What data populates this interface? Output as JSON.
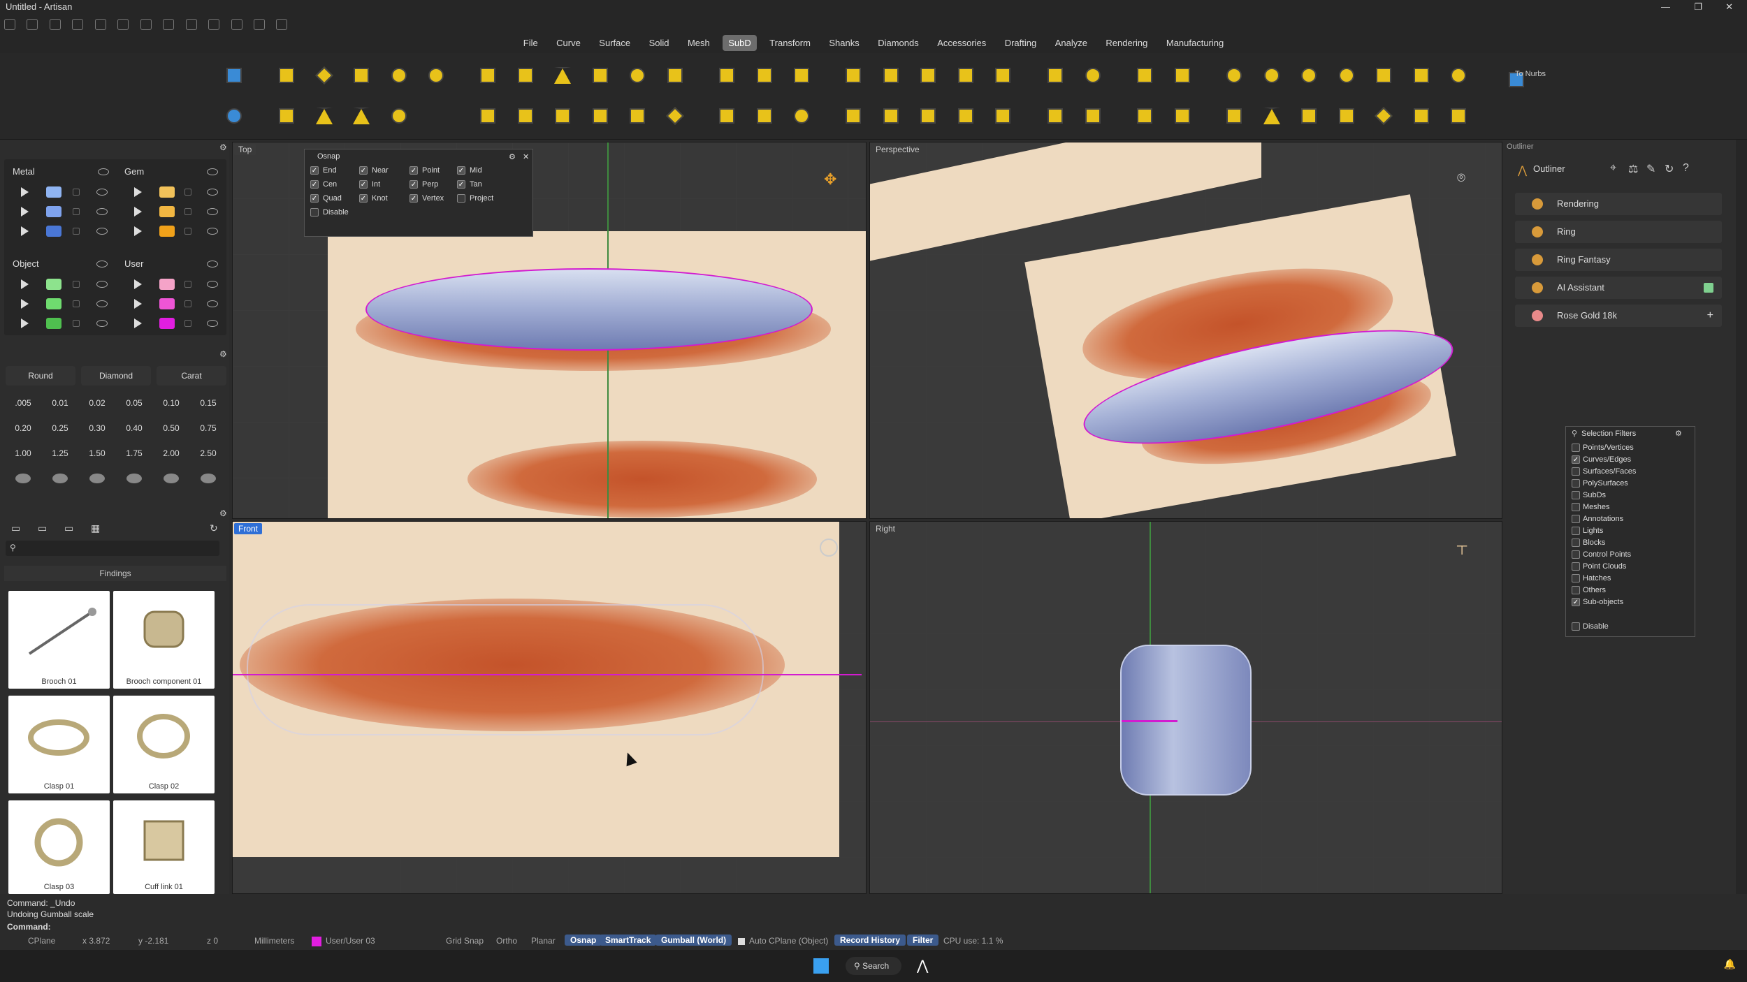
{
  "titlebar": {
    "title": "Untitled - Artisan"
  },
  "menu": {
    "items": [
      "File",
      "Curve",
      "Surface",
      "Solid",
      "Mesh",
      "SubD",
      "Transform",
      "Shanks",
      "Diamonds",
      "Accessories",
      "Drafting",
      "Analyze",
      "Rendering",
      "Manufacturing"
    ],
    "active": "SubD"
  },
  "toolbar": {
    "to_nurbs_label": "To Nurbs"
  },
  "layers": {
    "metal": {
      "label": "Metal",
      "colors": [
        "#8fb4f2",
        "#7fa3ee",
        "#4a77d6"
      ]
    },
    "gem": {
      "label": "Gem",
      "colors": [
        "#f2c25a",
        "#f2b742",
        "#f0a11a"
      ]
    },
    "object": {
      "label": "Object",
      "colors": [
        "#8de38d",
        "#6fdc6f",
        "#4fc04f"
      ]
    },
    "user": {
      "label": "User",
      "colors": [
        "#f5a3c8",
        "#ee55d6",
        "#e21ee0"
      ]
    }
  },
  "gems": {
    "shape": "Round",
    "type": "Diamond",
    "unit": "Carat",
    "sizes": [
      ".005",
      "0.01",
      "0.02",
      "0.05",
      "0.10",
      "0.15",
      "0.20",
      "0.25",
      "0.30",
      "0.40",
      "0.50",
      "0.75",
      "1.00",
      "1.25",
      "1.50",
      "1.75",
      "2.00",
      "2.50"
    ]
  },
  "findings": {
    "title": "Findings",
    "items": [
      "Brooch 01",
      "Brooch component 01",
      "Clasp 01",
      "Clasp 02",
      "Clasp 03",
      "Cuff link 01"
    ]
  },
  "osnap": {
    "title": "Osnap",
    "options": [
      {
        "label": "End",
        "checked": true
      },
      {
        "label": "Near",
        "checked": true
      },
      {
        "label": "Point",
        "checked": true
      },
      {
        "label": "Mid",
        "checked": true
      },
      {
        "label": "Cen",
        "checked": true
      },
      {
        "label": "Int",
        "checked": true
      },
      {
        "label": "Perp",
        "checked": true
      },
      {
        "label": "Tan",
        "checked": true
      },
      {
        "label": "Quad",
        "checked": true
      },
      {
        "label": "Knot",
        "checked": true
      },
      {
        "label": "Vertex",
        "checked": true
      },
      {
        "label": "Project",
        "checked": false
      },
      {
        "label": "Disable",
        "checked": false
      }
    ]
  },
  "viewports": {
    "top": "Top",
    "perspective": "Perspective",
    "front": "Front",
    "right": "Right"
  },
  "outliner": {
    "title": "Outliner",
    "panel_label": "Outliner",
    "items": [
      "Rendering",
      "Ring",
      "Ring Fantasy",
      "AI Assistant",
      "Rose Gold 18k"
    ]
  },
  "selection_filters": {
    "title": "Selection Filters",
    "items": [
      {
        "label": "Points/Vertices",
        "checked": false
      },
      {
        "label": "Curves/Edges",
        "checked": true
      },
      {
        "label": "Surfaces/Faces",
        "checked": false
      },
      {
        "label": "PolySurfaces",
        "checked": false
      },
      {
        "label": "SubDs",
        "checked": false
      },
      {
        "label": "Meshes",
        "checked": false
      },
      {
        "label": "Annotations",
        "checked": false
      },
      {
        "label": "Lights",
        "checked": false
      },
      {
        "label": "Blocks",
        "checked": false
      },
      {
        "label": "Control Points",
        "checked": false
      },
      {
        "label": "Point Clouds",
        "checked": false
      },
      {
        "label": "Hatches",
        "checked": false
      },
      {
        "label": "Others",
        "checked": false
      },
      {
        "label": "Sub-objects",
        "checked": true
      }
    ],
    "disable": "Disable"
  },
  "command": {
    "history1": "Command: _Undo",
    "history2": "Undoing Gumball scale",
    "prompt": "Command:"
  },
  "status": {
    "cplane": "CPlane",
    "x": "x 3.872",
    "y": "y -2.181",
    "z": "z 0",
    "units": "Millimeters",
    "layer": "User/User 03",
    "layer_color": "#e21ee0",
    "grid_snap": "Grid Snap",
    "ortho": "Ortho",
    "planar": "Planar",
    "osnap": "Osnap",
    "smarttrack": "SmartTrack",
    "gumball": "Gumball (World)",
    "auto_cplane": "Auto CPlane (Object)",
    "record_history": "Record History",
    "filter": "Filter",
    "cpu": "CPU use: 1.1 %"
  },
  "taskbar": {
    "search": "Search"
  }
}
